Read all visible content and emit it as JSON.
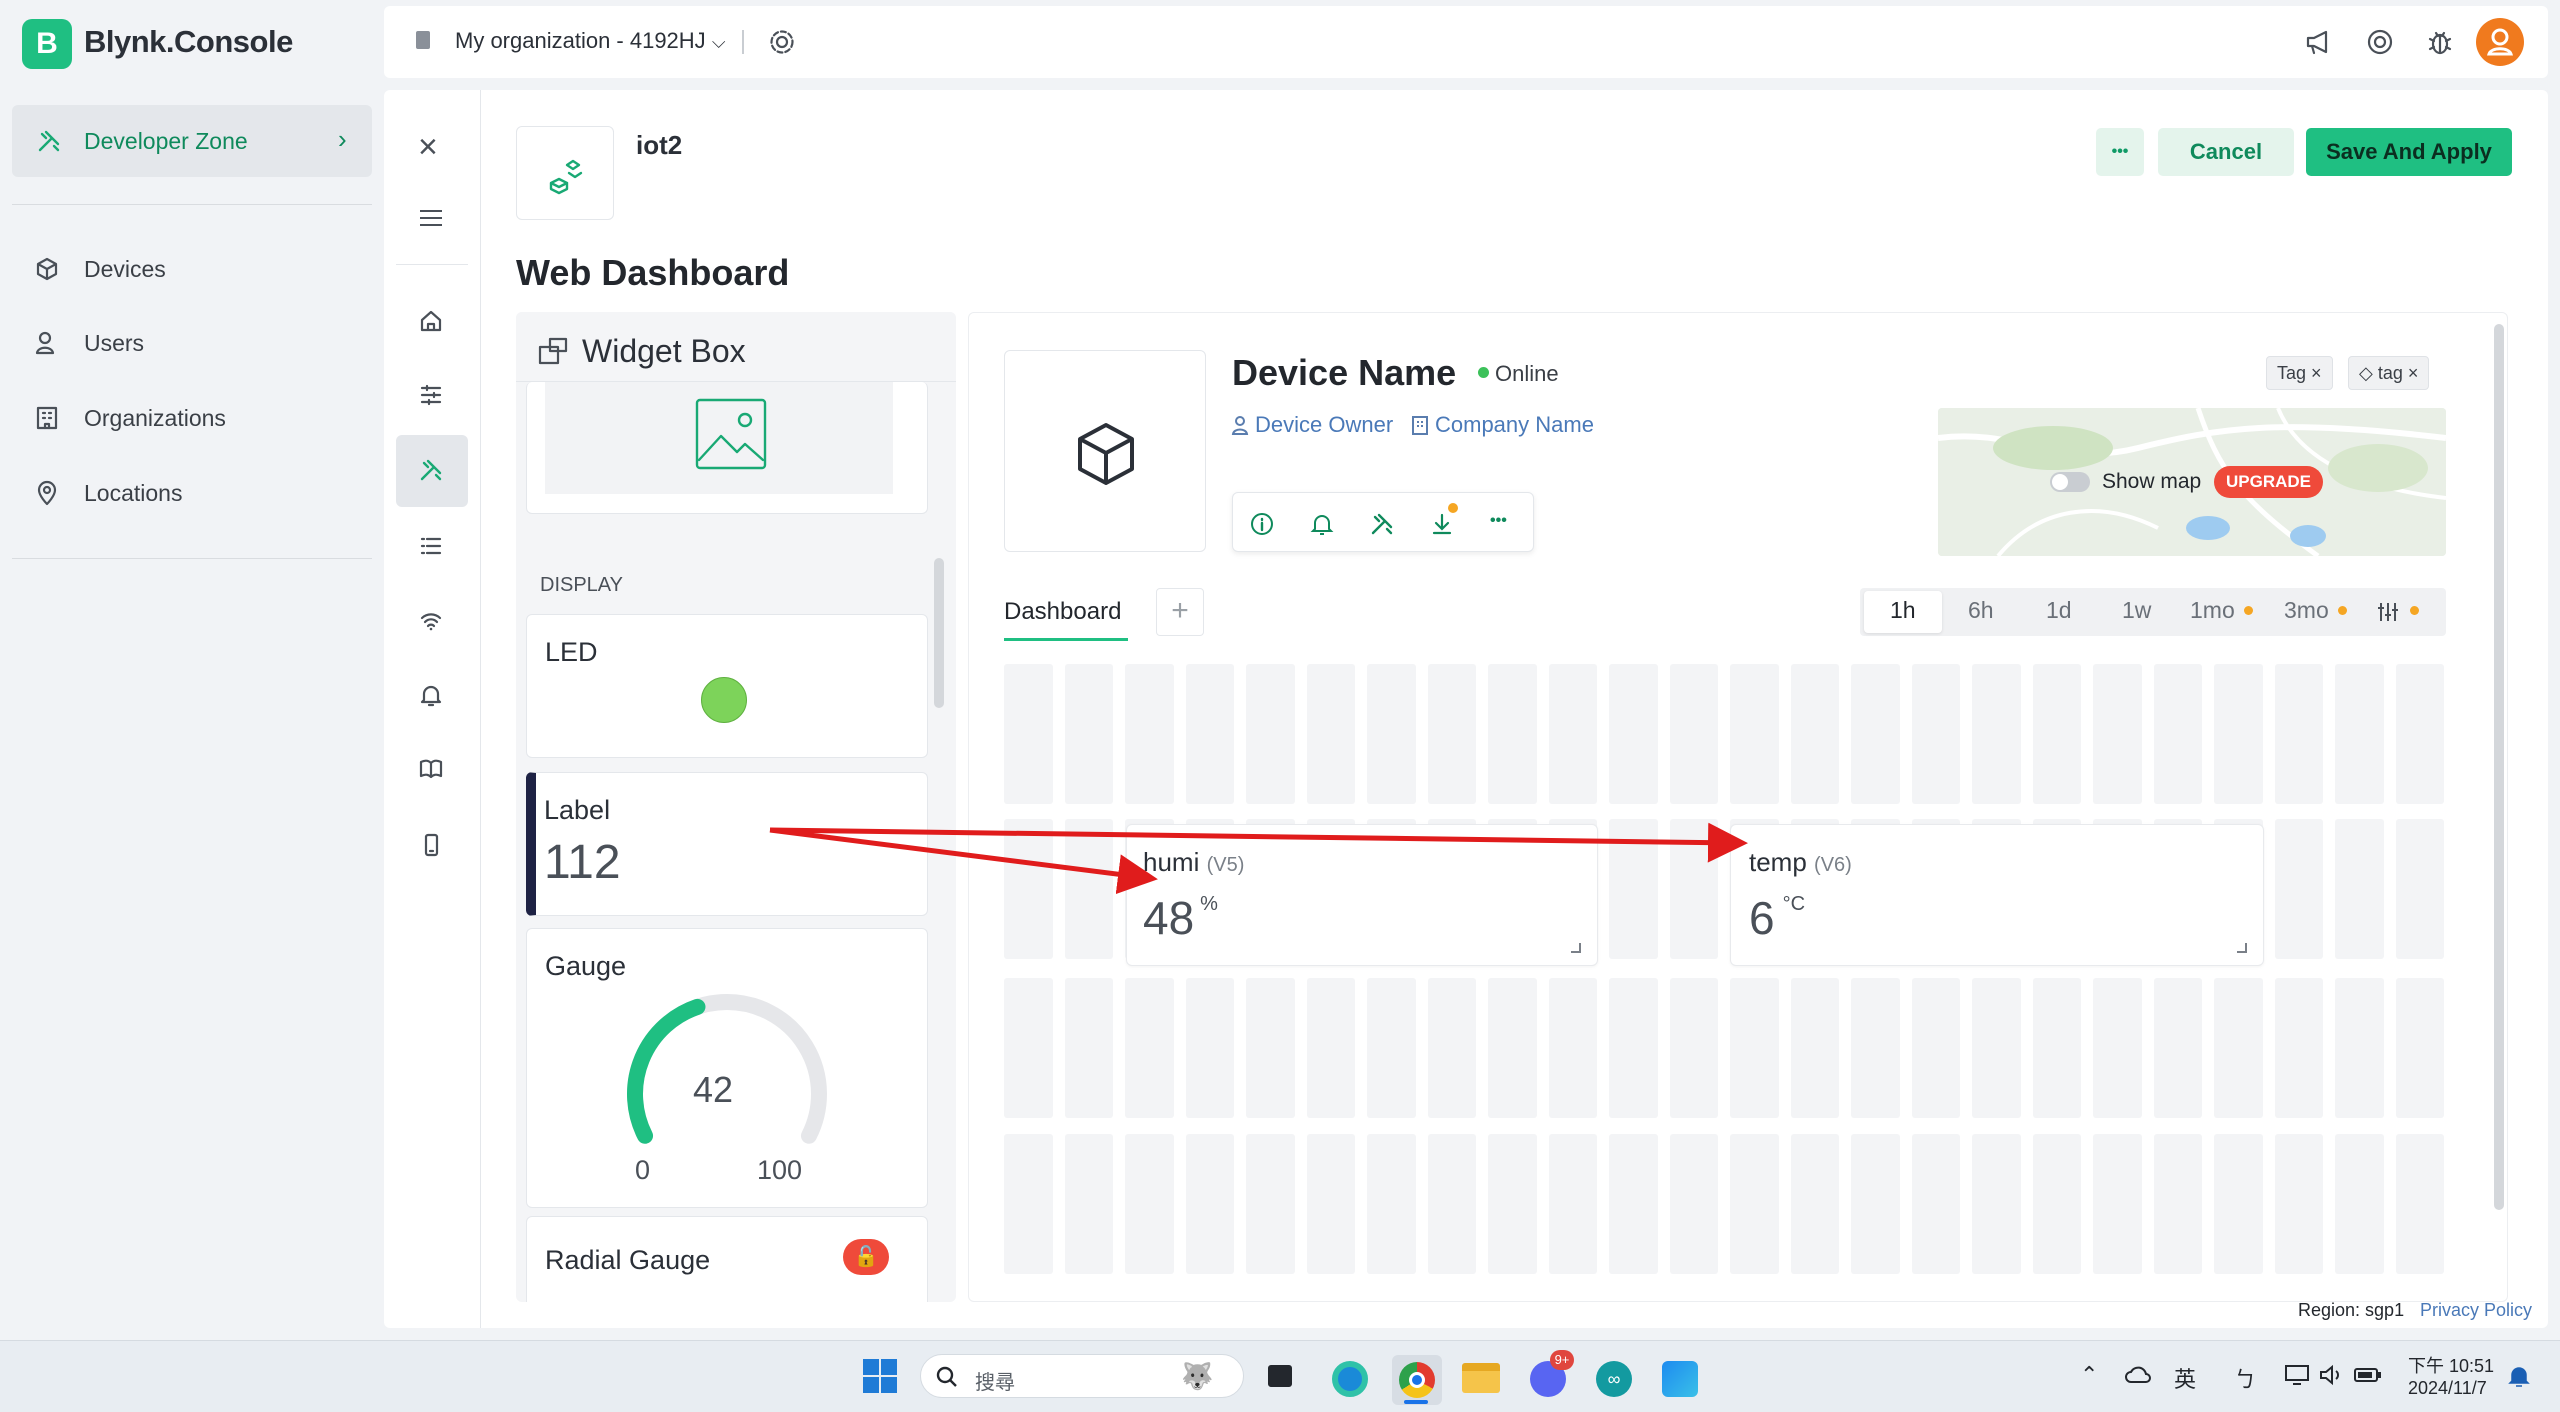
{
  "app": {
    "logo_letter": "B",
    "name": "Blynk.Console"
  },
  "topbar": {
    "org": "My organization - 4192HJ"
  },
  "sidebar": {
    "developer_zone": "Developer Zone",
    "items": [
      {
        "label": "Devices",
        "icon": "cube-icon"
      },
      {
        "label": "Users",
        "icon": "user-icon"
      },
      {
        "label": "Organizations",
        "icon": "building-icon"
      },
      {
        "label": "Locations",
        "icon": "pin-icon"
      }
    ]
  },
  "template": {
    "name": "iot2",
    "section_title": "Web Dashboard"
  },
  "actions": {
    "more": "•••",
    "cancel": "Cancel",
    "save": "Save And Apply"
  },
  "widget_box": {
    "title": "Widget Box",
    "category": "DISPLAY",
    "led": {
      "label": "LED",
      "color": "#7dd35a"
    },
    "label_widget": {
      "label": "Label",
      "value": "112"
    },
    "gauge": {
      "label": "Gauge",
      "value": "42",
      "min": "0",
      "max": "100",
      "level": 0.42
    },
    "radial": {
      "label": "Radial Gauge"
    }
  },
  "device": {
    "name": "Device Name",
    "status": "Online",
    "owner": "Device Owner",
    "company": "Company Name",
    "tags": [
      "Tag",
      "tag"
    ],
    "show_map": "Show map",
    "upgrade": "UPGRADE"
  },
  "dashboard": {
    "tab": "Dashboard",
    "add": "+",
    "ranges": [
      "1h",
      "6h",
      "1d",
      "1w",
      "1mo",
      "3mo"
    ],
    "widgets": [
      {
        "title": "humi",
        "pin": "(V5)",
        "value": "48",
        "unit": "%"
      },
      {
        "title": "temp",
        "pin": "(V6)",
        "value": "6",
        "unit": "°C"
      }
    ]
  },
  "footer": {
    "region": "Region: sgp1",
    "privacy": "Privacy Policy"
  },
  "taskbar": {
    "search": "搜尋",
    "ime": "英",
    "ime2": "ㄅ",
    "time": "下午 10:51",
    "date": "2024/11/7",
    "badge": "9+"
  },
  "colors": {
    "accent": "#1fbf82",
    "accent_dark": "#0f9a66",
    "online": "#3cc15a",
    "arrow": "#e01c1c",
    "upgrade": "#ef4a3a"
  }
}
